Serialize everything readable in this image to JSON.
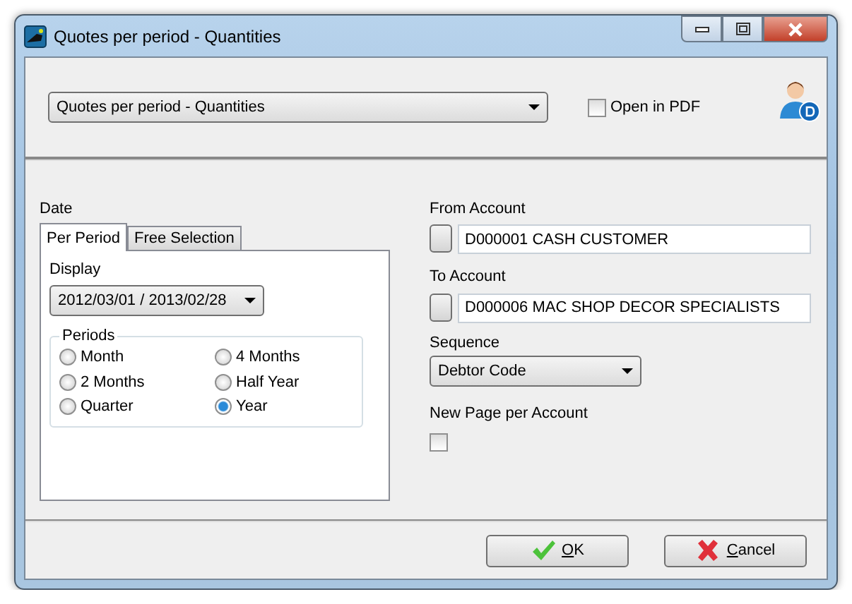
{
  "window": {
    "title": "Quotes per period - Quantities"
  },
  "report_select": {
    "value": "Quotes per period - Quantities"
  },
  "open_in_pdf": {
    "label": "Open in PDF",
    "checked": false
  },
  "date": {
    "label": "Date",
    "tabs": [
      {
        "label": "Per Period",
        "selected": true
      },
      {
        "label": "Free Selection",
        "selected": false
      }
    ],
    "display": {
      "label": "Display",
      "value": "2012/03/01 / 2013/02/28"
    },
    "periods": {
      "label": "Periods",
      "options": [
        {
          "label": "Month",
          "selected": false
        },
        {
          "label": "4 Months",
          "selected": false
        },
        {
          "label": "2 Months",
          "selected": false
        },
        {
          "label": "Half Year",
          "selected": false
        },
        {
          "label": "Quarter",
          "selected": false
        },
        {
          "label": "Year",
          "selected": true
        }
      ]
    }
  },
  "from_account": {
    "label": "From Account",
    "value": "D000001 CASH CUSTOMER"
  },
  "to_account": {
    "label": "To Account",
    "value": "D000006 MAC SHOP DECOR SPECIALISTS"
  },
  "sequence": {
    "label": "Sequence",
    "value": "Debtor Code"
  },
  "new_page_per_account": {
    "label": "New Page per Account",
    "checked": false
  },
  "buttons": [
    {
      "label": "OK",
      "kind": "ok"
    },
    {
      "label": "Cancel",
      "kind": "cancel"
    }
  ]
}
